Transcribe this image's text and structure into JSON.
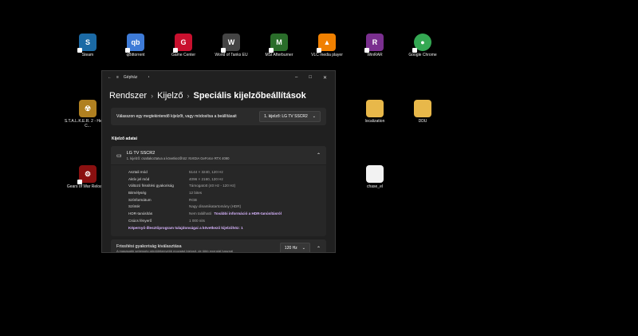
{
  "desktop": {
    "icons": [
      {
        "label": "Steam",
        "icon": "steam-icon",
        "color": "#1b6aa5",
        "glyph": "S"
      },
      {
        "label": "qBittorrent",
        "icon": "qbittorrent-icon",
        "color": "#3e7bd7",
        "glyph": "qb"
      },
      {
        "label": "Game Center",
        "icon": "game-center-icon",
        "color": "#c8102e",
        "glyph": "G"
      },
      {
        "label": "World of Tanks EU",
        "icon": "world-of-tanks-icon",
        "color": "#444444",
        "glyph": "W"
      },
      {
        "label": "MSI Afterburner",
        "icon": "msi-afterburner-icon",
        "color": "#2a6d2a",
        "glyph": "M"
      },
      {
        "label": "VLC media player",
        "icon": "vlc-icon",
        "color": "#f08000",
        "glyph": "▲"
      },
      {
        "label": "WinRAR",
        "icon": "winrar-icon",
        "color": "#7a2f8f",
        "glyph": "R"
      },
      {
        "label": "Google Chrome",
        "icon": "chrome-icon",
        "color": "#34a853",
        "glyph": "●"
      },
      {
        "label": "S.T.A.L.K.E.R. 2 - Heart of C...",
        "icon": "stalker-icon",
        "color": "#b08020",
        "glyph": "☢"
      },
      {
        "label": "localization",
        "icon": "folder-icon",
        "color": "#e8b84a",
        "glyph": ""
      },
      {
        "label": "DDU",
        "icon": "folder-icon",
        "color": "#e8b84a",
        "glyph": ""
      },
      {
        "label": "Gears of War Reloaded",
        "icon": "gears-of-war-icon",
        "color": "#8a1010",
        "glyph": "⚙"
      },
      {
        "label": "chase_el",
        "icon": "file-icon",
        "color": "#f2f2f2",
        "glyph": ""
      }
    ]
  },
  "window": {
    "app_name": "Gépház",
    "controls": {
      "minimize": "–",
      "maximize": "□",
      "close": "✕"
    },
    "breadcrumb": {
      "level1": "Rendszer",
      "level2": "Kijelző",
      "current": "Speciális kijelzőbeállítások",
      "separator": "›"
    },
    "display_select": {
      "prompt": "Válasszon egy megtekintendő kijelzőt, vagy módosítsa a beállításait",
      "selected": "1. kijelző: LG TV SSCR2"
    },
    "section_title": "Kijelző adatai",
    "display_card": {
      "name": "LG TV SSCR2",
      "subtitle": "1. kijelző: csatlakoztatva a következőhöz: NVIDIA GeForce RTX 4090",
      "rows": [
        {
          "key": "Asztali mód",
          "value": "5144 × 3240, 120 Hz"
        },
        {
          "key": "Aktív jel mód",
          "value": "4096 × 2160, 120 Hz"
        },
        {
          "key": "Változó frissítési gyakoriság",
          "value": "Támogatott (40 Hz - 120 Hz)"
        },
        {
          "key": "Bitmélység",
          "value": "12 bites"
        },
        {
          "key": "Színformátum",
          "value": "RGB"
        },
        {
          "key": "Színtér",
          "value": "Nagy dinamikatartomány (HDR)"
        },
        {
          "key": "HDR-tanúsítás",
          "value": "Nem található",
          "link": "További információ a HDR-tanúsításról"
        },
        {
          "key": "Csúcs fényerő",
          "value": "1 000 nits"
        }
      ],
      "adapter_link": "Képernyő-illesztőprogram tulajdonságai a következő kijelzőhöz: 1"
    },
    "refresh": {
      "title": "Frissítési gyakoriság kiválasztása",
      "subtitle": "A magasabb sebesség gördülékenyebb mozgást biztosít, de több energiát használ",
      "value": "120 Hz"
    }
  }
}
